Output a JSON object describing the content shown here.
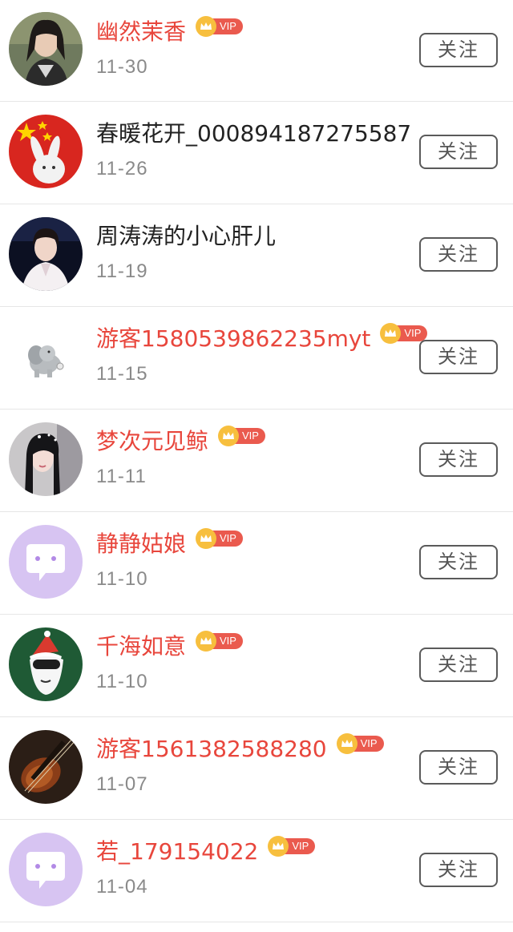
{
  "follow_label": "关注",
  "vip_label": "VIP",
  "colors": {
    "vip_name": "#e8463c",
    "normal_name": "#222222",
    "date": "#8a8a8a",
    "vip_badge": "#ea5a4e",
    "crown": "#f7bf3e"
  },
  "users": [
    {
      "name": "幽然茉香",
      "date": "11-30",
      "vip": true,
      "avatar": "photo-woman-avatar"
    },
    {
      "name": "春暖花开_000894187275587",
      "date": "11-26",
      "vip": false,
      "avatar": "flag-rabbit-avatar"
    },
    {
      "name": "周涛涛的小心肝儿",
      "date": "11-19",
      "vip": false,
      "avatar": "photo-host-avatar"
    },
    {
      "name": "游客1580539862235myt",
      "date": "11-15",
      "vip": true,
      "avatar": "elephant-avatar"
    },
    {
      "name": "梦次元见鲸",
      "date": "11-11",
      "vip": true,
      "avatar": "photo-girl-avatar"
    },
    {
      "name": "静静姑娘",
      "date": "11-10",
      "vip": true,
      "avatar": "default-chat-avatar"
    },
    {
      "name": "千海如意",
      "date": "11-10",
      "vip": true,
      "avatar": "christmas-cartoon-avatar"
    },
    {
      "name": "游客1561382588280",
      "date": "11-07",
      "vip": true,
      "avatar": "violin-avatar"
    },
    {
      "name": "若_179154022",
      "date": "11-04",
      "vip": true,
      "avatar": "default-chat-avatar"
    }
  ]
}
